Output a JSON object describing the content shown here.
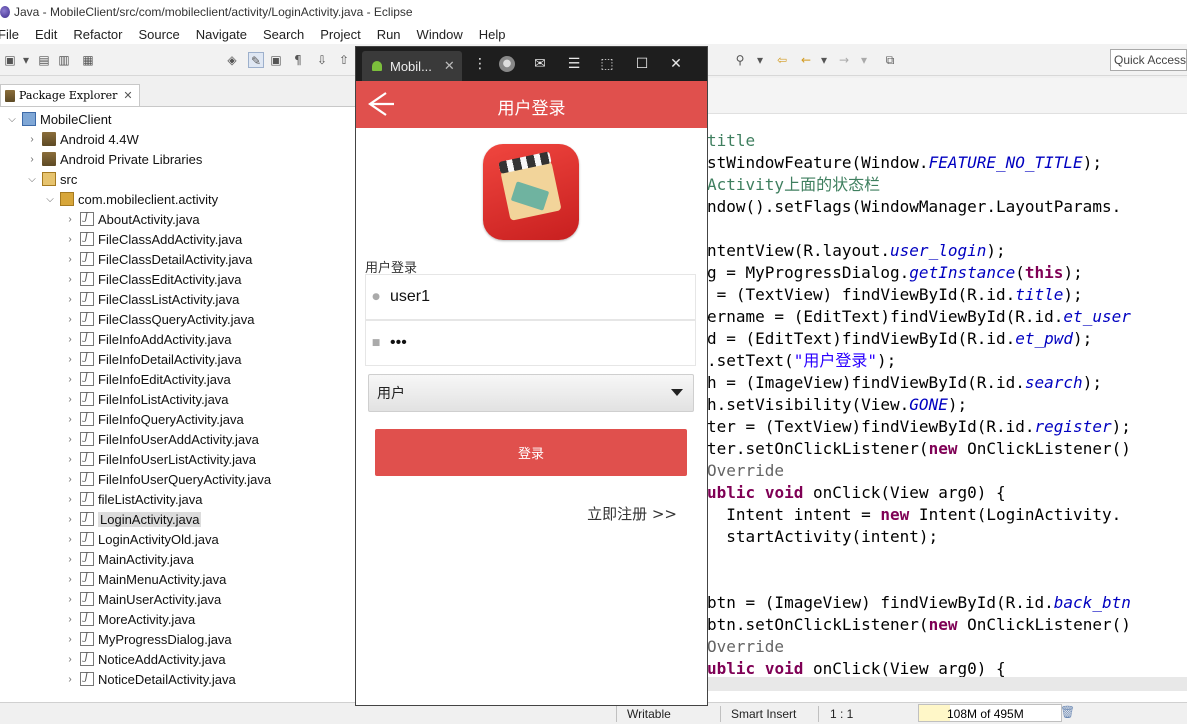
{
  "window": {
    "title": "Java - MobileClient/src/com/mobileclient/activity/LoginActivity.java - Eclipse"
  },
  "menu": [
    "File",
    "Edit",
    "Refactor",
    "Source",
    "Navigate",
    "Search",
    "Project",
    "Run",
    "Window",
    "Help"
  ],
  "toolbar": {
    "quick_access_placeholder": "Quick Access"
  },
  "package_explorer": {
    "tab_label": "Package Explorer",
    "close_glyph": "✕",
    "project": "MobileClient",
    "libs": [
      "Android 4.4W",
      "Android Private Libraries"
    ],
    "src": "src",
    "package": "com.mobileclient.activity",
    "files": [
      "AboutActivity.java",
      "FileClassAddActivity.java",
      "FileClassDetailActivity.java",
      "FileClassEditActivity.java",
      "FileClassListActivity.java",
      "FileClassQueryActivity.java",
      "FileInfoAddActivity.java",
      "FileInfoDetailActivity.java",
      "FileInfoEditActivity.java",
      "FileInfoListActivity.java",
      "FileInfoQueryActivity.java",
      "FileInfoUserAddActivity.java",
      "FileInfoUserListActivity.java",
      "FileInfoUserQueryActivity.java",
      "fileListActivity.java",
      "LoginActivity.java",
      "LoginActivityOld.java",
      "MainActivity.java",
      "MainMenuActivity.java",
      "MainUserActivity.java",
      "MoreActivity.java",
      "MyProgressDialog.java",
      "NoticeAddActivity.java",
      "NoticeDetailActivity.java"
    ],
    "selected_file": "LoginActivity.java"
  },
  "emulator": {
    "tab_label": "Mobil...",
    "header_title": "用户登录",
    "login_section_label": "用户登录",
    "username_value": "user1",
    "password_value": "•••",
    "role_value": "用户",
    "login_button": "登录",
    "register_link": "立即注册 >>"
  },
  "editor": {
    "lines": [
      "title",
      "stWindowFeature(Window.FEATURE_NO_TITLE);",
      "Activity上面的状态栏",
      "ndow().setFlags(WindowManager.LayoutParams.",
      "",
      "ntentView(R.layout.user_login);",
      "g = MyProgressDialog.getInstance(this);",
      " = (TextView) findViewById(R.id.title);",
      "ername = (EditText)findViewById(R.id.et_user",
      "d = (EditText)findViewById(R.id.et_pwd);",
      ".setText(\"用户登录\");",
      "h = (ImageView)findViewById(R.id.search);",
      "h.setVisibility(View.GONE);",
      "ter = (TextView)findViewById(R.id.register);",
      "ter.setOnClickListener(new OnClickListener()",
      "Override",
      "ublic void onClick(View arg0) {",
      "  Intent intent = new Intent(LoginActivity.",
      "  startActivity(intent);",
      "",
      "",
      "btn = (ImageView) findViewById(R.id.back_btn",
      "btn.setOnClickListener(new OnClickListener()",
      "Override",
      "ublic void onClick(View arg0) {"
    ]
  },
  "status_bar": {
    "writable": "Writable",
    "insert_mode": "Smart Insert",
    "position": "1 : 1",
    "heap": "108M of 495M",
    "heap_fraction": 0.218
  }
}
